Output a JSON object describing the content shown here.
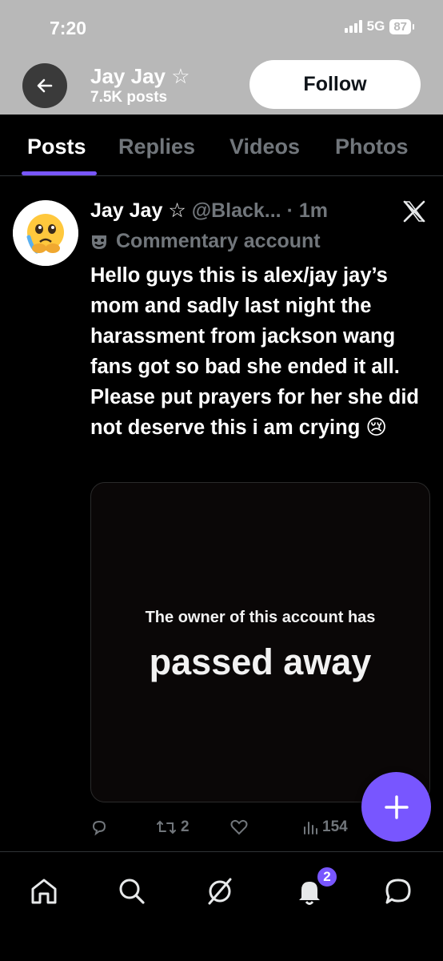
{
  "status_bar": {
    "time": "7:20",
    "network": "5G",
    "battery": "87"
  },
  "header": {
    "name": "Jay Jay ☆",
    "posts_count": "7.5K posts",
    "follow_label": "Follow"
  },
  "tabs": [
    {
      "label": "Posts",
      "active": true
    },
    {
      "label": "Replies",
      "active": false
    },
    {
      "label": "Videos",
      "active": false
    },
    {
      "label": "Photos",
      "active": false
    }
  ],
  "post": {
    "display_name": "Jay Jay ☆",
    "handle": "@Black...",
    "time": "· 1m",
    "label": "Commentary account",
    "text": "Hello guys this is alex/jay jay’s mom and sadly last night the harassment from jackson wang fans got so bad she ended it all. Please put prayers for her she did not deserve this i am crying 😢",
    "media_text_small": "The owner of this account has",
    "media_text_big": "passed away",
    "reposts": "2",
    "views": "154"
  },
  "bottom_nav": {
    "notifications_badge": "2"
  },
  "colors": {
    "accent": "#7856ff",
    "header_bg": "#b8b8b8",
    "muted": "#71767b"
  }
}
